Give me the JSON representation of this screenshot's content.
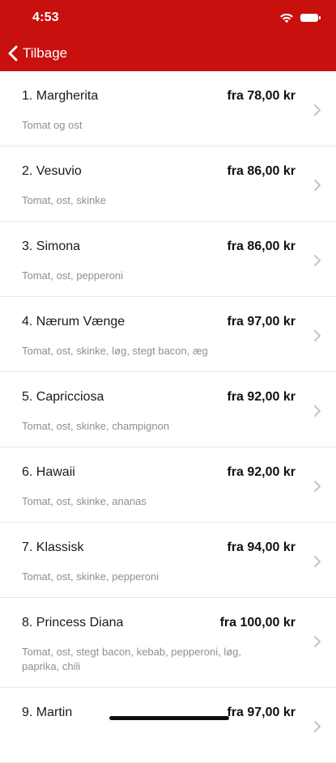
{
  "status_bar": {
    "time": "4:53"
  },
  "nav": {
    "back_label": "Tilbage"
  },
  "colors": {
    "accent": "#c8100f",
    "muted_text": "#8f8f8f"
  },
  "items": [
    {
      "name": "1. Margherita",
      "price": "fra 78,00 kr",
      "desc": "Tomat og  ost"
    },
    {
      "name": "2. Vesuvio",
      "price": "fra 86,00 kr",
      "desc": "Tomat, ost, skinke"
    },
    {
      "name": "3. Simona",
      "price": "fra 86,00 kr",
      "desc": "Tomat, ost, pepperoni"
    },
    {
      "name": "4. Nærum Vænge",
      "price": "fra 97,00 kr",
      "desc": "Tomat, ost, skinke, løg, stegt bacon, æg"
    },
    {
      "name": "5. Capricciosa",
      "price": "fra 92,00 kr",
      "desc": "Tomat, ost, skinke, champignon"
    },
    {
      "name": "6. Hawaii",
      "price": "fra 92,00 kr",
      "desc": "Tomat, ost, skinke, ananas"
    },
    {
      "name": "7. Klassisk",
      "price": "fra 94,00 kr",
      "desc": "Tomat, ost, skinke, pepperoni"
    },
    {
      "name": "8. Princess Diana",
      "price": "fra 100,00 kr",
      "desc": "Tomat, ost, stegt bacon, kebab, pepperoni, løg, paprika, chili"
    },
    {
      "name": "9. Martin",
      "price": "fra 97,00 kr",
      "desc": ""
    }
  ]
}
